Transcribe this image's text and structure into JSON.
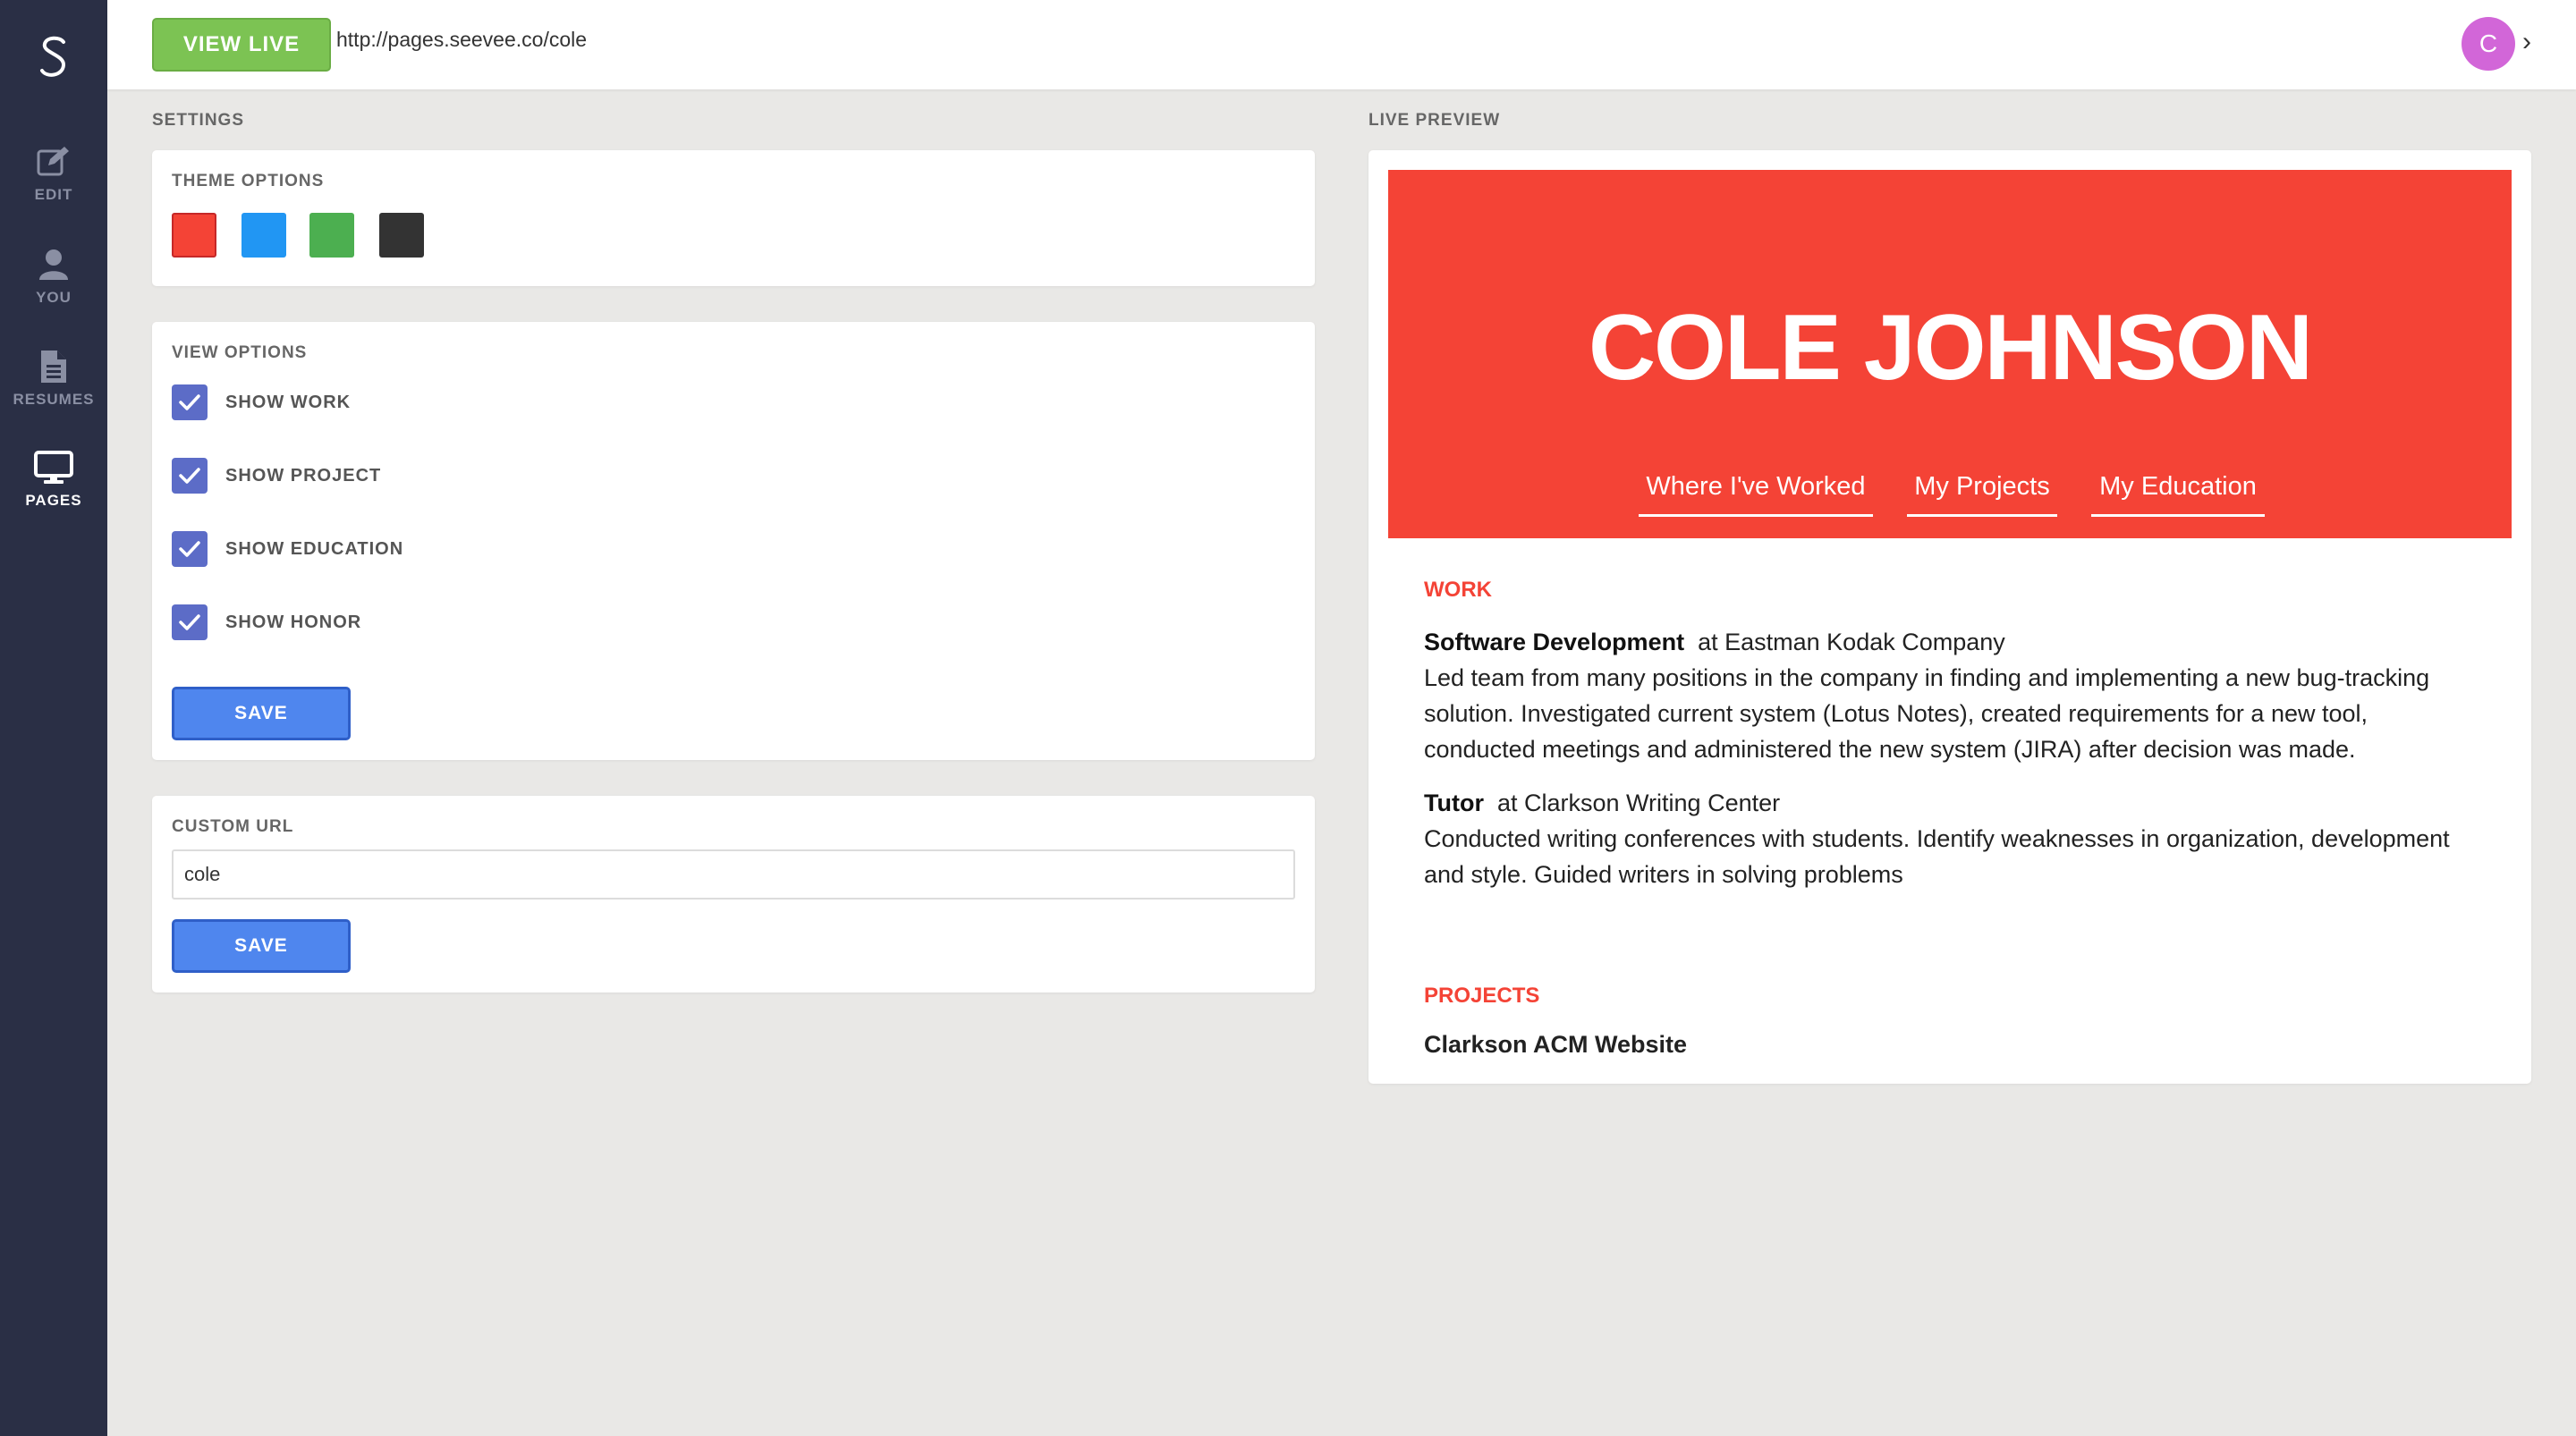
{
  "sidebar": {
    "logo": "S",
    "items": [
      {
        "label": "EDIT",
        "icon": "edit-icon",
        "active": false
      },
      {
        "label": "YOU",
        "icon": "user-icon",
        "active": false
      },
      {
        "label": "RESUMES",
        "icon": "document-icon",
        "active": false
      },
      {
        "label": "PAGES",
        "icon": "monitor-icon",
        "active": true
      }
    ]
  },
  "topbar": {
    "view_live_label": "VIEW LIVE",
    "url": "http://pages.seevee.co/cole",
    "avatar_initial": "C",
    "avatar_chevron": "›"
  },
  "settings": {
    "section_label": "SETTINGS",
    "theme": {
      "title": "THEME OPTIONS",
      "swatches": [
        "#f44336",
        "#2196f3",
        "#4caf50",
        "#333333"
      ]
    },
    "view_options": {
      "title": "VIEW OPTIONS",
      "options": [
        {
          "label": "SHOW WORK",
          "checked": true
        },
        {
          "label": "SHOW PROJECT",
          "checked": true
        },
        {
          "label": "SHOW EDUCATION",
          "checked": true
        },
        {
          "label": "SHOW HONOR",
          "checked": true
        }
      ],
      "save_label": "SAVE"
    },
    "custom_url": {
      "title": "CUSTOM URL",
      "value": "cole",
      "save_label": "SAVE"
    }
  },
  "preview": {
    "section_label": "LIVE PREVIEW",
    "name": "COLE JOHNSON",
    "nav": [
      "Where I've Worked",
      "My Projects",
      "My Education"
    ],
    "work_heading": "WORK",
    "jobs": [
      {
        "title": "Software Development",
        "company": "at Eastman Kodak Company",
        "lines": [
          "Led team from many positions in the company in finding and implementing a new bug-tracking",
          "solution. Investigated current system (Lotus Notes), created requirements for a new tool,",
          "conducted meetings and administered the new system (JIRA) after decision was made."
        ]
      },
      {
        "title": "Tutor",
        "company": "at Clarkson Writing Center",
        "lines": [
          "Conducted writing conferences with students. Identify weaknesses in organization, development",
          "and style. Guided writers in solving problems"
        ]
      }
    ],
    "projects_heading": "PROJECTS",
    "projects": [
      "Clarkson ACM Website"
    ]
  },
  "colors": {
    "sidebar_bg": "#2a2f45",
    "accent_green": "#7cc353",
    "accent_blue": "#4f86ee",
    "checkbox": "#5c6cc7",
    "theme_red": "#f44336",
    "avatar": "#d266d8"
  }
}
